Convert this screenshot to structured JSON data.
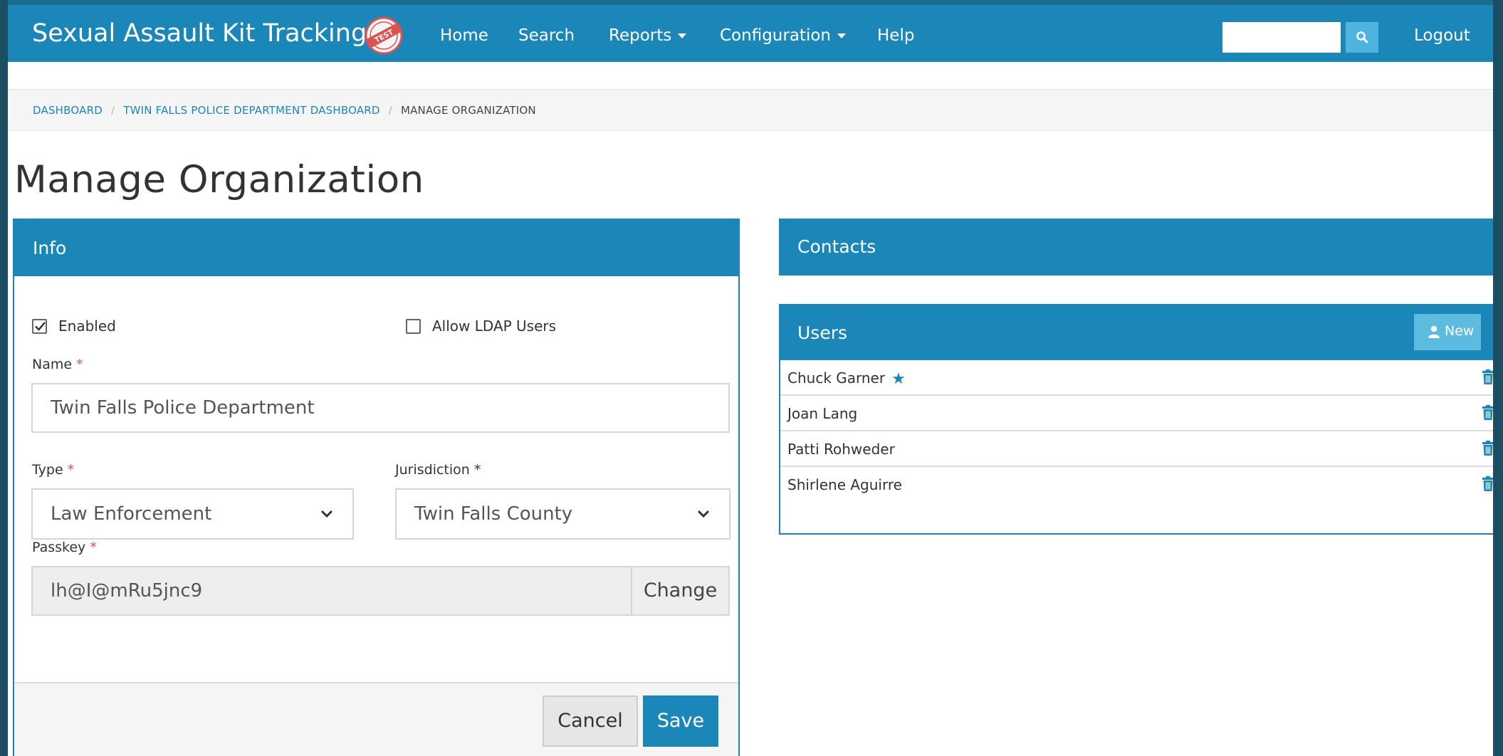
{
  "app": {
    "brand": "Sexual Assault Kit Tracking",
    "stamp_text": "TEST"
  },
  "nav": {
    "home": "Home",
    "search": "Search",
    "reports": "Reports",
    "configuration": "Configuration",
    "help": "Help",
    "search_value": "",
    "logout": "Logout"
  },
  "breadcrumb": {
    "items": [
      "DASHBOARD",
      "TWIN FALLS POLICE DEPARTMENT DASHBOARD",
      "MANAGE ORGANIZATION"
    ],
    "separator": "/"
  },
  "page": {
    "title": "Manage Organization"
  },
  "info": {
    "title": "Info",
    "enabled_label": "Enabled",
    "enabled_checked": true,
    "ldap_label": "Allow LDAP Users",
    "ldap_checked": false,
    "name_label": "Name",
    "name_value": "Twin Falls Police Department",
    "type_label": "Type",
    "type_value": "Law Enforcement",
    "jurisdiction_label": "Jurisdiction",
    "jurisdiction_value": "Twin Falls County",
    "passkey_label": "Passkey",
    "passkey_value": "lh@I@mRu5jnc9",
    "change_label": "Change",
    "required_marker": "*",
    "cancel_label": "Cancel",
    "save_label": "Save"
  },
  "contacts": {
    "title": "Contacts"
  },
  "users": {
    "title": "Users",
    "new_label": "New",
    "list": [
      {
        "name": "Chuck Garner",
        "primary": true
      },
      {
        "name": "Joan Lang",
        "primary": false
      },
      {
        "name": "Patti Rohweder",
        "primary": false
      },
      {
        "name": "Shirlene Aguirre",
        "primary": false
      }
    ]
  },
  "colors": {
    "primary": "#1b87b8",
    "navbar_border": "#1b6a8f",
    "side_border": "#1b4e63",
    "required": "#d9534f",
    "new_button": "#5dbbe0"
  },
  "icons": {
    "search": "search-icon",
    "caret": "caret-down-icon",
    "check": "check-icon",
    "chevron": "chevron-down-icon",
    "user": "user-icon",
    "star": "star-icon",
    "trash": "trash-icon",
    "stamp": "test-stamp-icon"
  }
}
